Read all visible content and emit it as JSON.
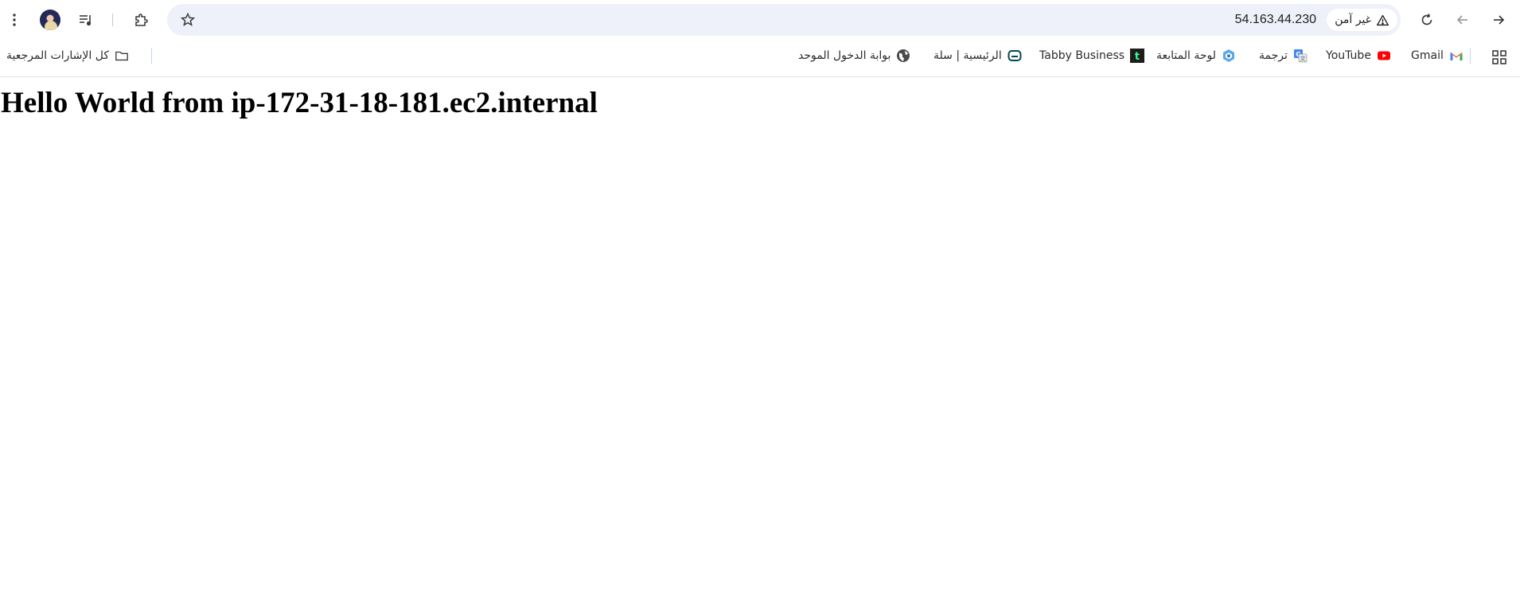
{
  "toolbar": {
    "address": "54.163.44.230",
    "security_label": "غير آمن"
  },
  "bookmarks": [
    {
      "name": "bookmark-gmail",
      "label": "Gmail",
      "icon": "gmail-icon"
    },
    {
      "name": "bookmark-youtube",
      "label": "YouTube",
      "icon": "youtube-icon"
    },
    {
      "name": "bookmark-translate",
      "label": "ترجمة",
      "icon": "translate-icon"
    },
    {
      "name": "bookmark-dashboard",
      "label": "لوحة المتابعة",
      "icon": "dashboard-logo-icon"
    },
    {
      "name": "bookmark-tabby",
      "label": "Tabby Business",
      "icon": "tabby-icon"
    },
    {
      "name": "bookmark-salla",
      "label": "الرئيسية | سلة",
      "icon": "salla-icon"
    },
    {
      "name": "bookmark-unified-login",
      "label": "بوابة الدخول الموحد",
      "icon": "globe-icon"
    }
  ],
  "all_bookmarks_label": "كل الإشارات المرجعية",
  "page": {
    "heading": "Hello World from ip-172-31-18-181.ec2.internal"
  },
  "colors": {
    "omnibox_bg": "#eef1f9",
    "youtube_red": "#ff0000",
    "tabby_bg": "#1d1d1b",
    "salla_teal": "#004956"
  }
}
